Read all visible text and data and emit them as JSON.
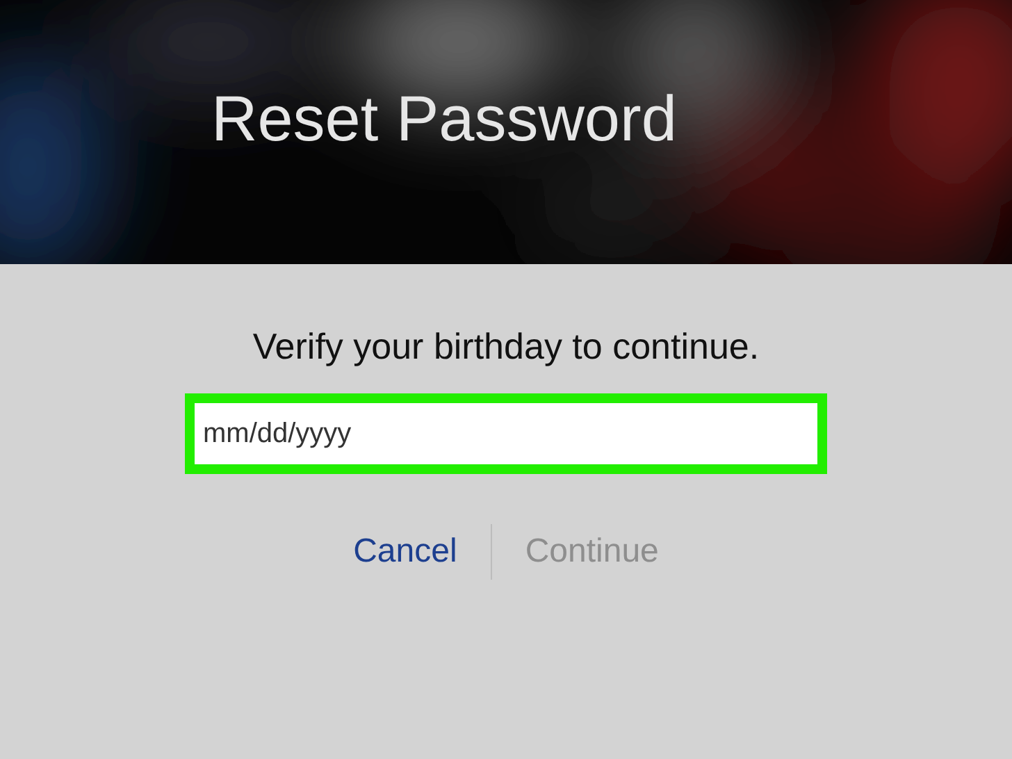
{
  "header": {
    "title": "Reset Password",
    "kind": "picture"
  },
  "prompt": "Verify your birthday to continue.",
  "birthday_field": {
    "placeholder": "mm/dd/yyyy"
  },
  "buttons": [
    {
      "label": "Cancel",
      "disabled": false
    },
    {
      "label": "Continue",
      "disabled": true
    }
  ]
}
